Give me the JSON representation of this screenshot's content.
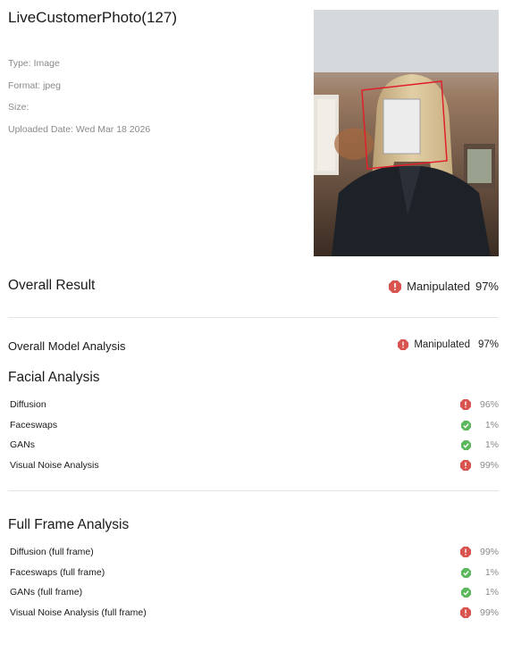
{
  "file": {
    "title": "LiveCustomerPhoto(127)",
    "type": "Type: Image",
    "format": "Format: jpeg",
    "size": "Size:",
    "uploaded": "Uploaded Date: Wed Mar 18 2026"
  },
  "colors": {
    "manipulated": "#d9534f",
    "authentic": "#5cb85c",
    "divider": "#e3e3e3",
    "detection_box": "#e0202a"
  },
  "overall": {
    "label": "Overall Result",
    "status": "Manipulated",
    "percent": "97%"
  },
  "model": {
    "label": "Overall Model Analysis",
    "status": "Manipulated",
    "percent": "97%"
  },
  "facial": {
    "title": "Facial Analysis",
    "rows": [
      {
        "label": "Diffusion",
        "percent": "96%",
        "icon": "alert-icon"
      },
      {
        "label": "Faceswaps",
        "percent": "1%",
        "icon": "check-icon"
      },
      {
        "label": "GANs",
        "percent": "1%",
        "icon": "check-icon"
      },
      {
        "label": "Visual Noise Analysis",
        "percent": "99%",
        "icon": "alert-icon"
      }
    ]
  },
  "full_frame": {
    "title": "Full Frame Analysis",
    "rows": [
      {
        "label": "Diffusion (full frame)",
        "percent": "99%",
        "icon": "alert-icon"
      },
      {
        "label": "Faceswaps (full frame)",
        "percent": "1%",
        "icon": "check-icon"
      },
      {
        "label": "GANs (full frame)",
        "percent": "1%",
        "icon": "check-icon"
      },
      {
        "label": "Visual Noise Analysis (full frame)",
        "percent": "99%",
        "icon": "alert-icon"
      }
    ]
  }
}
